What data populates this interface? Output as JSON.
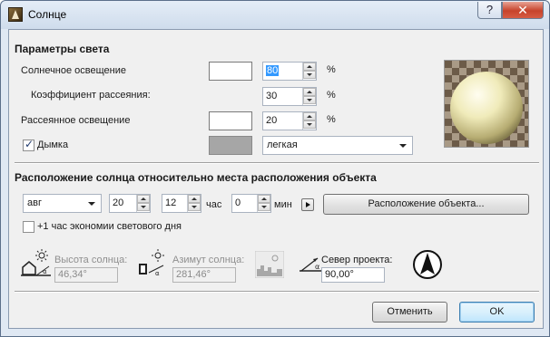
{
  "window": {
    "title": "Солнце",
    "help_label": "?",
    "close_label": "✕"
  },
  "light": {
    "section_title": "Параметры света",
    "sun_label": "Солнечное освещение",
    "sun_value": "80",
    "scatter_label": "Коэффициент рассеяния:",
    "scatter_value": "30",
    "ambient_label": "Рассеянное освещение",
    "ambient_value": "20",
    "haze_label": "Дымка",
    "haze_checked": true,
    "haze_option": "легкая",
    "percent": "%"
  },
  "position": {
    "section_title": "Расположение солнца относительно места расположения объекта",
    "month": "авг",
    "day": "20",
    "hour": "12",
    "hour_unit": "час",
    "minute": "0",
    "minute_unit": "мин",
    "location_button": "Расположение объекта...",
    "dst_label": "+1 час экономии светового дня",
    "dst_checked": false
  },
  "readouts": {
    "altitude_label": "Высота солнца:",
    "altitude_value": "46,34°",
    "azimuth_label": "Азимут солнца:",
    "azimuth_value": "281,46°",
    "north_label": "Север проекта:",
    "north_value": "90,00°"
  },
  "footer": {
    "cancel_label": "Отменить",
    "ok_label": "OK"
  },
  "colors": {
    "title_bar": "#cfdcec",
    "client_bg": "#f0f0f0",
    "haze_swatch": "#a6a6a6",
    "selection": "#3399ff",
    "close_button": "#c7432b",
    "sphere": "#f3efc4"
  }
}
